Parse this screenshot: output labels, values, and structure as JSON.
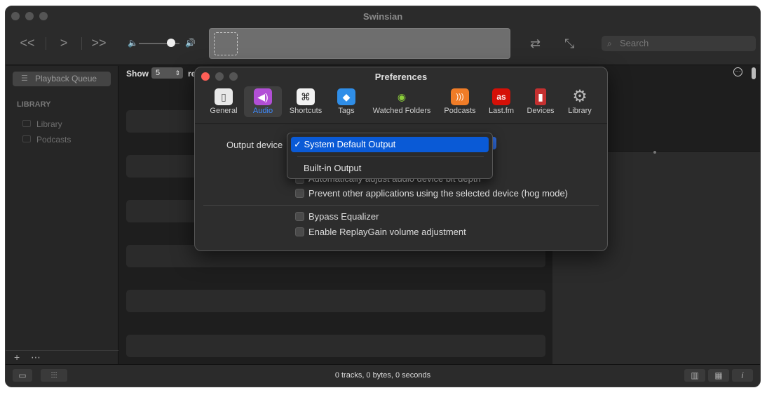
{
  "window": {
    "title": "Swinsian"
  },
  "toolbar": {
    "prev_glyph": "<<",
    "play_glyph": ">",
    "next_glyph": ">>",
    "vol_low_glyph": "🔈",
    "vol_high_glyph": "🔊",
    "volume_level": 0.8,
    "shuffle_glyph": "⇄",
    "mini_glyph": "⤡",
    "search_placeholder": "Search",
    "search_glyph": "⌕"
  },
  "sidebar": {
    "queue_label": "Playback Queue",
    "queue_glyph": "☰",
    "library_header": "LIBRARY",
    "items": [
      {
        "label": "Library"
      },
      {
        "label": "Podcasts"
      }
    ],
    "add_glyph": "+",
    "more_glyph": "⋯"
  },
  "main": {
    "show_label": "Show",
    "show_value": "5",
    "show_arrow": "⇕",
    "show_rest": "re"
  },
  "right_pane": {
    "more_glyph": "⋯"
  },
  "statusbar": {
    "text": "0 tracks,  0 bytes,  0 seconds",
    "sidebar_glyph": "▭",
    "eq_glyph": "⫶⫶⫶",
    "view1_glyph": "▥",
    "view2_glyph": "▦",
    "info_glyph": "i"
  },
  "prefs": {
    "title": "Preferences",
    "tabs": [
      {
        "label": "General",
        "glyph": "▯",
        "color": "#e8e8e8"
      },
      {
        "label": "Audio",
        "glyph": "◀)",
        "color": "#b24fd6"
      },
      {
        "label": "Shortcuts",
        "glyph": "⌘",
        "color": "#f2f2f2"
      },
      {
        "label": "Tags",
        "glyph": "◆",
        "color": "#2f8ee8"
      },
      {
        "label": "Watched Folders",
        "glyph": "◉",
        "color": "#8ccf3a"
      },
      {
        "label": "Podcasts",
        "glyph": ")))",
        "color": "#f07c27"
      },
      {
        "label": "Last.fm",
        "glyph": "as",
        "color": "#d51007"
      },
      {
        "label": "Devices",
        "glyph": "▮",
        "color": "#c43030"
      },
      {
        "label": "Library",
        "glyph": "⚙",
        "color": "#9a9a9a"
      }
    ],
    "output_device_label": "Output device",
    "option_partial_1": "te",
    "option_partial_2": "Automatically adjust audio device bit depth",
    "hog_mode_label": "Prevent other applications using the selected device (hog mode)",
    "bypass_eq_label": "Bypass Equalizer",
    "replaygain_label": "Enable ReplayGain volume adjustment"
  },
  "dropdown": {
    "selected": "✓ System Default Output",
    "options": [
      "Built-in Output"
    ]
  }
}
